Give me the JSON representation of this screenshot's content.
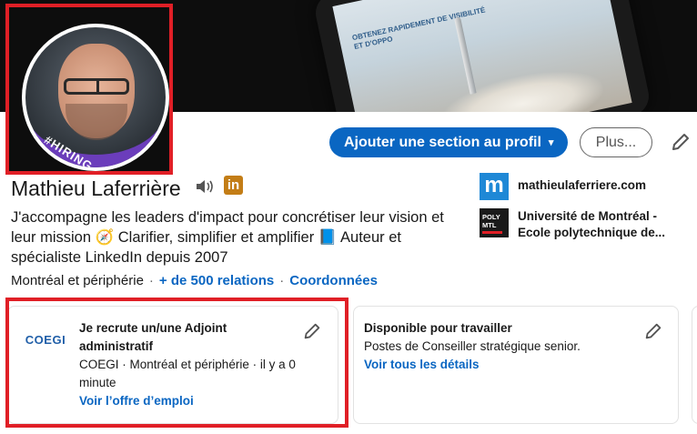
{
  "banner": {
    "caption": "OBTENEZ RAPIDEMENT DE VISIBILITÉ ET D'OPPO"
  },
  "profile": {
    "hiring_label": "#HIRING",
    "name": "Mathieu Laferrière",
    "linkedin_badge": "in",
    "headline": "J'accompagne les leaders d'impact pour concrétiser leur vision et leur mission 🧭 Clarifier, simplifier et amplifier 📘 Auteur et spécialiste LinkedIn depuis 2007",
    "location": "Montréal et périphérie",
    "separator": "·",
    "connections": "+ de 500 relations",
    "contact": "Coordonnées"
  },
  "actions": {
    "add_section": "Ajouter une section au profil",
    "caret": "▾",
    "more": "Plus..."
  },
  "side": {
    "website": "mathieulaferriere.com",
    "website_logo": "m",
    "school": "Université de Montréal - Ecole polytechnique de...",
    "school_logo_line1": "POLY",
    "school_logo_line2": "MTL"
  },
  "cards": {
    "hiring": {
      "company_logo": "COEGI",
      "title": "Je recrute un/une Adjoint administratif",
      "meta": "COEGI · Montréal et périphérie · il y a 0 minute",
      "link": "Voir l’offre d’emploi"
    },
    "open_to_work": {
      "title": "Disponible pour travailler",
      "meta": "Postes de Conseiller stratégique senior.",
      "link": "Voir tous les détails"
    }
  },
  "colors": {
    "accent": "#0a66c2",
    "highlight": "#e01f26",
    "hiring_frame": "#6f3fc2",
    "linkedin_badge": "#c37d16"
  }
}
